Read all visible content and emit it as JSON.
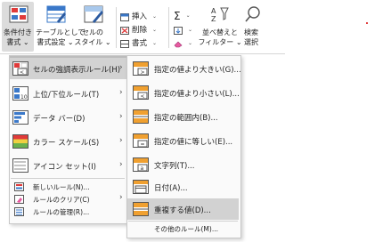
{
  "ribbon": {
    "conditional_formatting": "条件付き\n書式 ⌄",
    "format_as_table": "テーブルとして\n書式設定 ⌄",
    "cell_styles": "セルの\nスタイル ⌄",
    "insert": "挿入",
    "delete": "削除",
    "format": "書式",
    "sort_filter": "並べ替えと\nフィルター ⌄",
    "find_select": "検索\n選択"
  },
  "main_menu": {
    "items": [
      {
        "label": "セルの強調表示ルール(H)",
        "icon": "highlight-rules-icon",
        "submenu": true
      },
      {
        "label": "上位/下位ルール(T)",
        "icon": "top-bottom-icon",
        "submenu": true
      },
      {
        "label": "データ バー(D)",
        "icon": "data-bars-icon",
        "submenu": true
      },
      {
        "label": "カラー スケール(S)",
        "icon": "color-scales-icon",
        "submenu": true
      },
      {
        "label": "アイコン セット(I)",
        "icon": "icon-sets-icon",
        "submenu": true
      }
    ],
    "small_items": [
      {
        "label": "新しいルール(N)...",
        "icon": "new-rule-icon"
      },
      {
        "label": "ルールのクリア(C)",
        "icon": "clear-rules-icon",
        "submenu": true
      },
      {
        "label": "ルールの管理(R)...",
        "icon": "manage-rules-icon"
      }
    ]
  },
  "sub_menu": {
    "items": [
      {
        "label": "指定の値より大きい(G)...",
        "icon": "greater-than-icon"
      },
      {
        "label": "指定の値より小さい(L)...",
        "icon": "less-than-icon"
      },
      {
        "label": "指定の範囲内(B)...",
        "icon": "between-icon"
      },
      {
        "label": "指定の値に等しい(E)...",
        "icon": "equal-to-icon"
      },
      {
        "label": "文字列(T)...",
        "icon": "text-contains-icon"
      },
      {
        "label": "日付(A)...",
        "icon": "date-occurring-icon"
      },
      {
        "label": "重複する値(D)...",
        "icon": "duplicate-values-icon"
      }
    ],
    "more_rules": "その他のルール(M)..."
  },
  "colors": {
    "highlight": "#d2d2d2",
    "accent_red": "#e03a3a",
    "accent_blue": "#3a78c9",
    "accent_orange": "#f0a030"
  }
}
